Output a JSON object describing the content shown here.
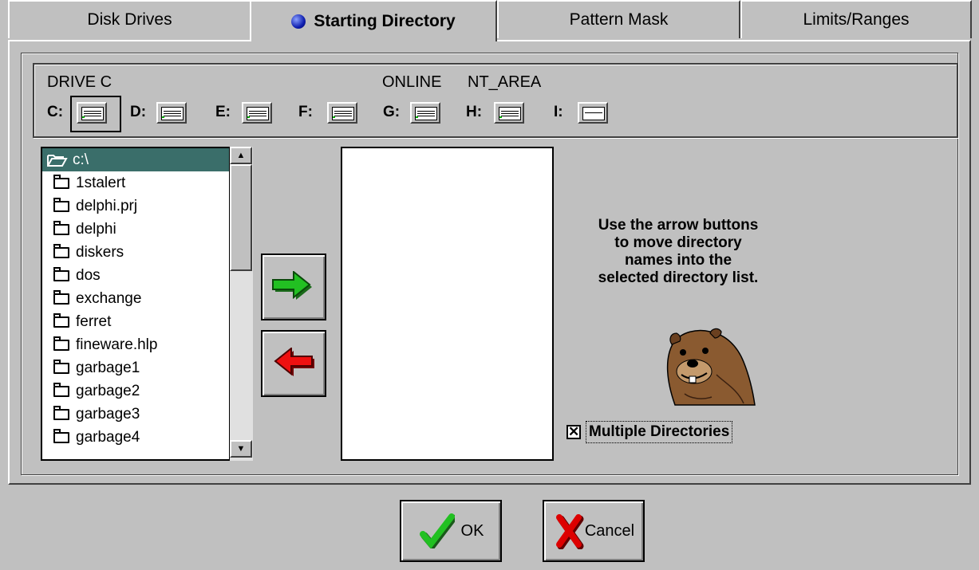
{
  "tabs": [
    {
      "label": "Disk Drives"
    },
    {
      "label": "Starting Directory",
      "active": true
    },
    {
      "label": "Pattern Mask"
    },
    {
      "label": "Limits/Ranges"
    }
  ],
  "drive_bar": {
    "drive_label": "DRIVE C",
    "online_label": "ONLINE",
    "area_label": "NT_AREA",
    "selected_drive": "C:",
    "drives": [
      "C:",
      "D:",
      "E:",
      "F:",
      "G:",
      "H:",
      "I:"
    ]
  },
  "directory_list": {
    "root": "c:\\",
    "folders": [
      "1stalert",
      "delphi.prj",
      "delphi",
      "diskers",
      "dos",
      "exchange",
      "ferret",
      "fineware.hlp",
      "garbage1",
      "garbage2",
      "garbage3",
      "garbage4"
    ],
    "scroll_up": "▲",
    "scroll_down": "▼"
  },
  "arrows": {
    "add_icon": "green-right-arrow-icon",
    "remove_icon": "red-left-arrow-icon"
  },
  "help_text": [
    "Use the arrow buttons",
    "to move directory",
    "names into the",
    "selected directory list."
  ],
  "mascot": "groundhog-icon",
  "multiple_directories": {
    "label": "Multiple Directories",
    "checked": true,
    "mark": "✕"
  },
  "buttons": {
    "ok": "OK",
    "cancel": "Cancel"
  },
  "colors": {
    "face": "#c0c0c0",
    "selection": "#3a6e6a",
    "ok_check": "#22c022",
    "cancel_x": "#dd0000"
  }
}
